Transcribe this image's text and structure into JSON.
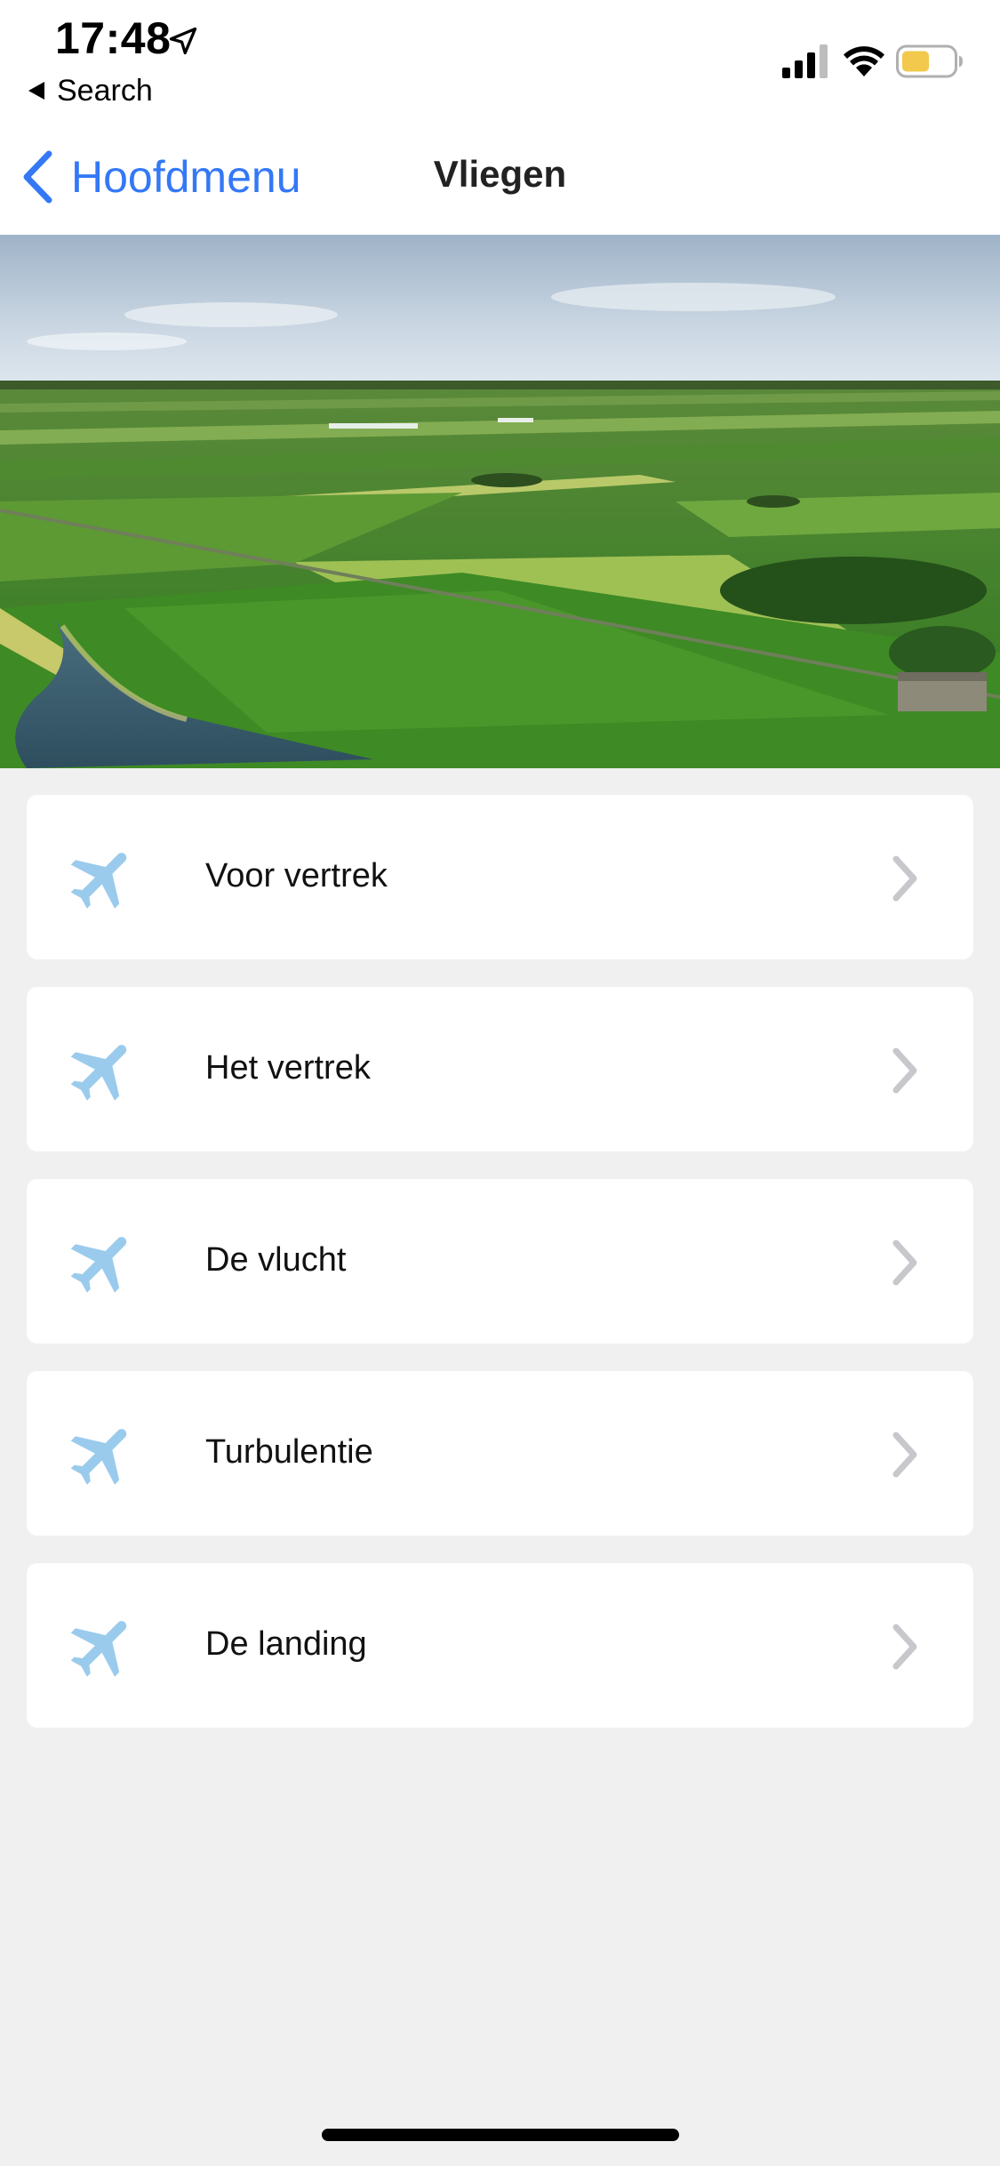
{
  "status_bar": {
    "time": "17:48",
    "back_app_label": "Search",
    "battery_color": "#f2c94c"
  },
  "nav": {
    "back_label": "Hoofdmenu",
    "title": "Vliegen",
    "accent_color": "#3478f6"
  },
  "hero": {
    "description_icon": "landscape-photo"
  },
  "menu": {
    "items": [
      {
        "label": "Voor vertrek",
        "icon": "airplane-icon"
      },
      {
        "label": "Het vertrek",
        "icon": "airplane-icon"
      },
      {
        "label": "De vlucht",
        "icon": "airplane-icon"
      },
      {
        "label": "Turbulentie",
        "icon": "airplane-icon"
      },
      {
        "label": "De landing",
        "icon": "airplane-icon"
      }
    ],
    "icon_color": "#9acbed",
    "chevron_color": "#c7c7cc"
  }
}
